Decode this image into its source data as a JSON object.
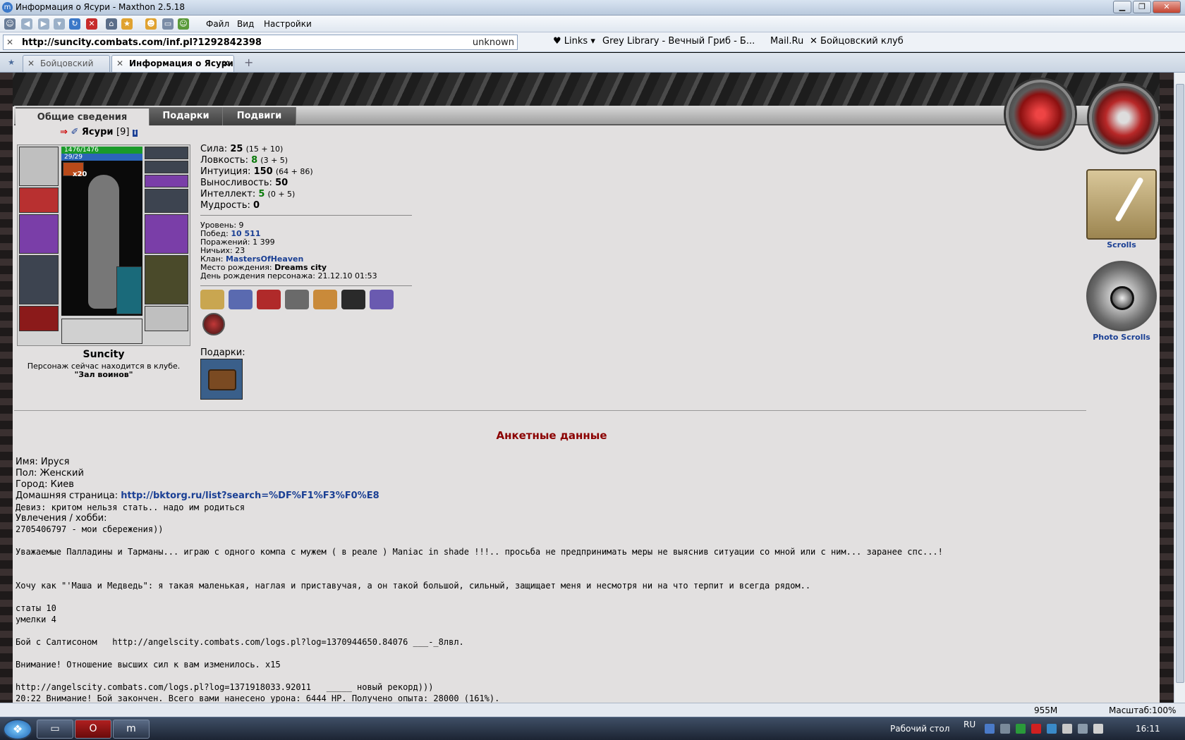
{
  "window": {
    "title": "Информация о Ясури - Maxthon 2.5.18",
    "minimize": "▁",
    "maximize": "❐",
    "close": "✕"
  },
  "menu": {
    "file": "Файл",
    "view": "Вид",
    "settings": "Настройки"
  },
  "address": {
    "url": "http://suncity.combats.com/inf.pl?1292842398",
    "security": "unknown"
  },
  "links": {
    "links_label": "Links",
    "grey_library": "Grey Library - Вечный Гриб - Б...",
    "mailru": "Mail.Ru",
    "fight_club": "Бойцовский клуб"
  },
  "tabs": [
    {
      "label": "Бойцовский клуб"
    },
    {
      "label": "Информация о Ясури"
    }
  ],
  "site_tabs": [
    "Общие сведения",
    "Подарки",
    "Подвиги"
  ],
  "character": {
    "name": "Ясури",
    "level": "[9]",
    "hp": "1476/1476",
    "mp": "29/29",
    "potion_count": "x20",
    "city": "Suncity",
    "location_line": "Персонаж сейчас находится в клубе.",
    "location_place": "\"Зал воинов\""
  },
  "stats": [
    {
      "label": "Сила:",
      "value": "25",
      "detail": "(15 + 10)",
      "color": "black"
    },
    {
      "label": "Ловкость:",
      "value": "8",
      "detail": "(3 + 5)",
      "color": "green"
    },
    {
      "label": "Интуиция:",
      "value": "150",
      "detail": "(64 + 86)",
      "color": "black"
    },
    {
      "label": "Выносливость:",
      "value": "50",
      "detail": "",
      "color": "black"
    },
    {
      "label": "Интеллект:",
      "value": "5",
      "detail": "(0 + 5)",
      "color": "green"
    },
    {
      "label": "Мудрость:",
      "value": "0",
      "detail": "",
      "color": "black"
    }
  ],
  "info": {
    "level_label": "Уровень:",
    "level": "9",
    "wins_label": "Побед:",
    "wins": "10 511",
    "losses_label": "Поражений:",
    "losses": "1 399",
    "draws_label": "Ничьих:",
    "draws": "23",
    "clan_label": "Клан:",
    "clan": "MastersOfHeaven",
    "birthplace_label": "Место рождения:",
    "birthplace": "Dreams city",
    "birthday_label": "День рождения персонажа:",
    "birthday": "21.12.10 01:53"
  },
  "gifts_label": "Подарки:",
  "right_panel": {
    "scrolls": "Scrolls",
    "photo_scrolls": "Photo Scrolls"
  },
  "section_title": "Анкетные данные",
  "anketa": {
    "name": "Имя: Ируся",
    "gender": "Пол: Женский",
    "city": "Город: Киев",
    "homepage_label": "Домашняя страница:",
    "homepage": "http://bktorg.ru/list?search=%DF%F1%F3%F0%E8",
    "motto": "Девиз: критом нельзя стать.. надо им родиться",
    "hobbies": "Увлечения / хобби:",
    "line1": "2705406797 - мои сбережения))",
    "line2": "Уважаемые Палладины и Тарманы... играю с одного компа с мужем ( в реале ) Maniac in shade !!!.. просьба не предпринимать меры не выяснив ситуации со мной или с ним... заранее спс...!",
    "line3": "Хочу как \"'Маша и Медведь\": я такая маленькая, наглая и приставучая, а он такой большой, сильный, защищает меня и несмотря ни на что терпит и всегда рядом..",
    "line4": "статы 10",
    "line5": "умелки 4",
    "line6": "Бой с Салтисоном   http://angelscity.combats.com/logs.pl?log=1370944650.84076 ___-_8лвл.",
    "line7": "Внимание! Отношение высших сил к вам изменилось. x15",
    "line8": "http://angelscity.combats.com/logs.pl?log=1371918033.92011   _____ новый рекорд)))",
    "line9": "20:22 Внимание! Бой закончен. Всего вами нанесено урона: 6444 HP. Получено опыта: 28000 (161%)."
  },
  "status": {
    "memory": "955M",
    "zoom": "Масштаб:100%"
  },
  "taskbar": {
    "desktop": "Рабочий стол",
    "lang": "RU",
    "clock": "16:11"
  }
}
